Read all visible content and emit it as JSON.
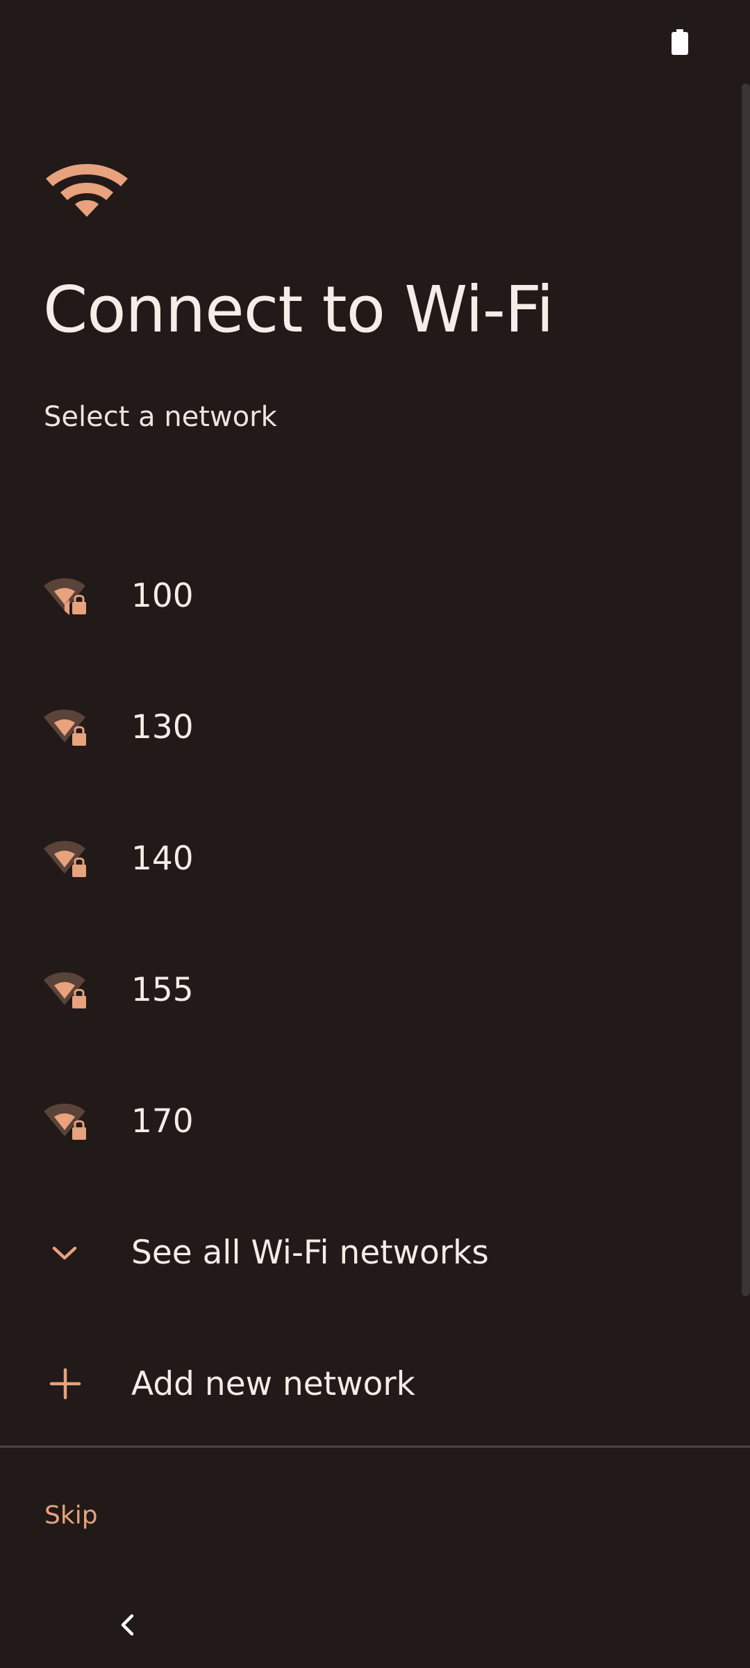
{
  "colors": {
    "background": "#211a18",
    "accent": "#e8a27d",
    "text": "#f5ece7",
    "divider": "#4a4442",
    "wifi_signal_dim": "#5a4339"
  },
  "status_bar": {
    "battery_icon": "battery-icon"
  },
  "header": {
    "icon": "wifi-icon",
    "title": "Connect to Wi-Fi",
    "subtitle": "Select a network"
  },
  "networks": [
    {
      "name": "100",
      "icon": "wifi-lock-icon",
      "secured": true
    },
    {
      "name": "130",
      "icon": "wifi-lock-icon",
      "secured": true
    },
    {
      "name": "140",
      "icon": "wifi-lock-icon",
      "secured": true
    },
    {
      "name": "155",
      "icon": "wifi-lock-icon",
      "secured": true
    },
    {
      "name": "170",
      "icon": "wifi-lock-icon",
      "secured": true
    }
  ],
  "actions": {
    "see_all": {
      "label": "See all Wi-Fi networks",
      "icon": "chevron-down-icon"
    },
    "add_new": {
      "label": "Add new network",
      "icon": "plus-icon"
    }
  },
  "footer": {
    "skip_label": "Skip"
  },
  "nav_bar": {
    "back_icon": "back-chevron-icon"
  }
}
